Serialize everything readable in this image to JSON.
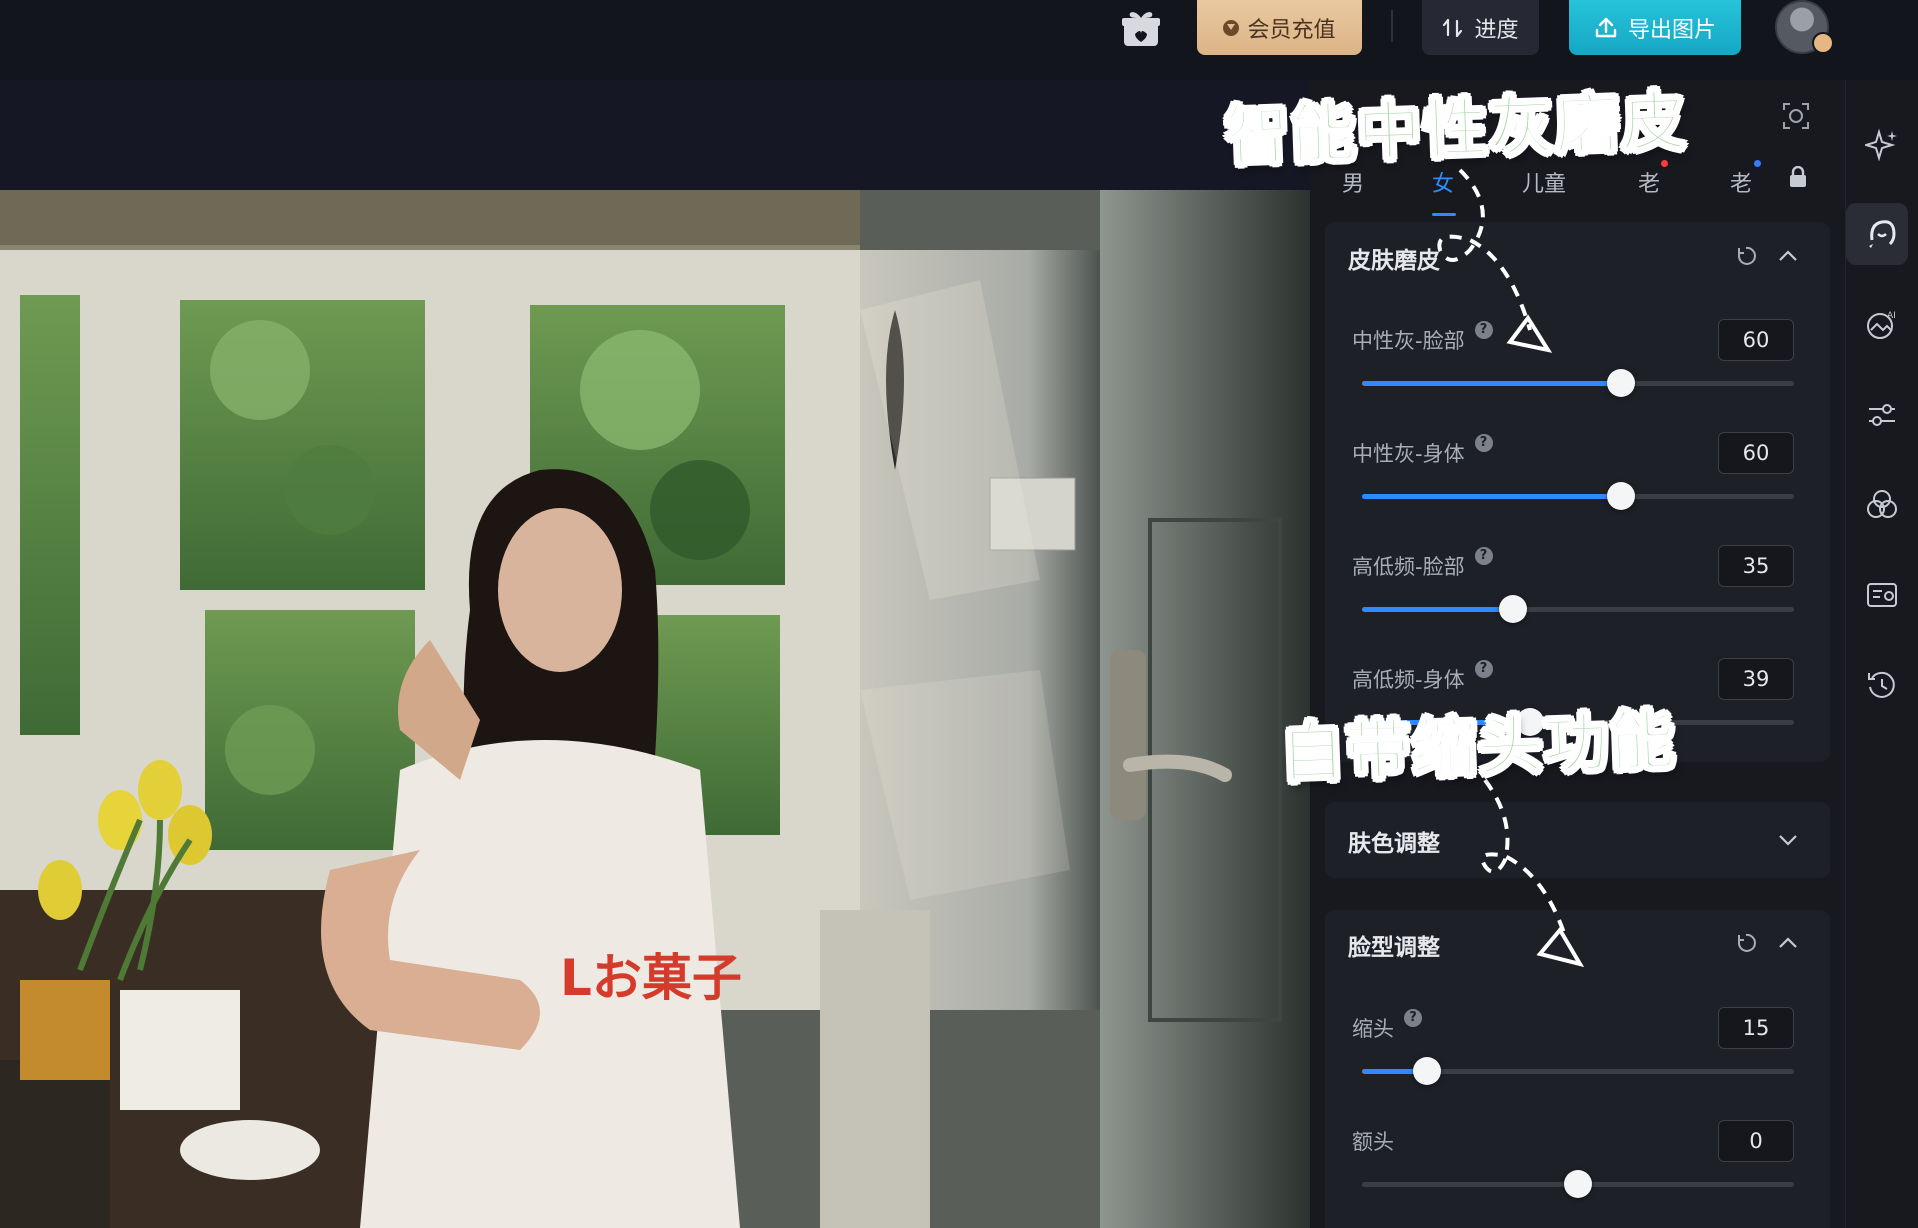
{
  "topbar": {
    "vip_label": "会员充值",
    "progress_label": "进度",
    "export_label": "导出图片"
  },
  "panel": {
    "tabs": [
      {
        "label": "男",
        "active": false
      },
      {
        "label": "女",
        "active": true
      },
      {
        "label": "儿童",
        "active": false
      },
      {
        "label": "老",
        "active": false,
        "badge": "red"
      },
      {
        "label": "老",
        "active": false,
        "badge": "blue",
        "locked": true
      }
    ],
    "skin_section": {
      "title": "皮肤磨皮",
      "sliders": [
        {
          "label": "中性灰-脸部",
          "value": "60",
          "ratio": 0.6
        },
        {
          "label": "中性灰-身体",
          "value": "60",
          "ratio": 0.6
        },
        {
          "label": "高低频-脸部",
          "value": "35",
          "ratio": 0.35
        },
        {
          "label": "高低频-身体",
          "value": "39",
          "ratio": 0.39
        }
      ]
    },
    "tone_section": {
      "title": "肤色调整"
    },
    "face_section": {
      "title": "脸型调整",
      "sliders": [
        {
          "label": "缩头",
          "value": "15",
          "ratio": 0.15
        },
        {
          "label": "额头",
          "value": "0",
          "ratio": 0.5
        }
      ]
    }
  },
  "annotations": {
    "top": "智能中性灰磨皮",
    "mid": "自带缩头功能"
  },
  "photo": {
    "shirt_text": "Lお菓子"
  },
  "colors": {
    "accent": "#2e8bff",
    "export": "#1fb6d0",
    "vip": "#e3be94",
    "annotation": "#a9d6a9"
  }
}
